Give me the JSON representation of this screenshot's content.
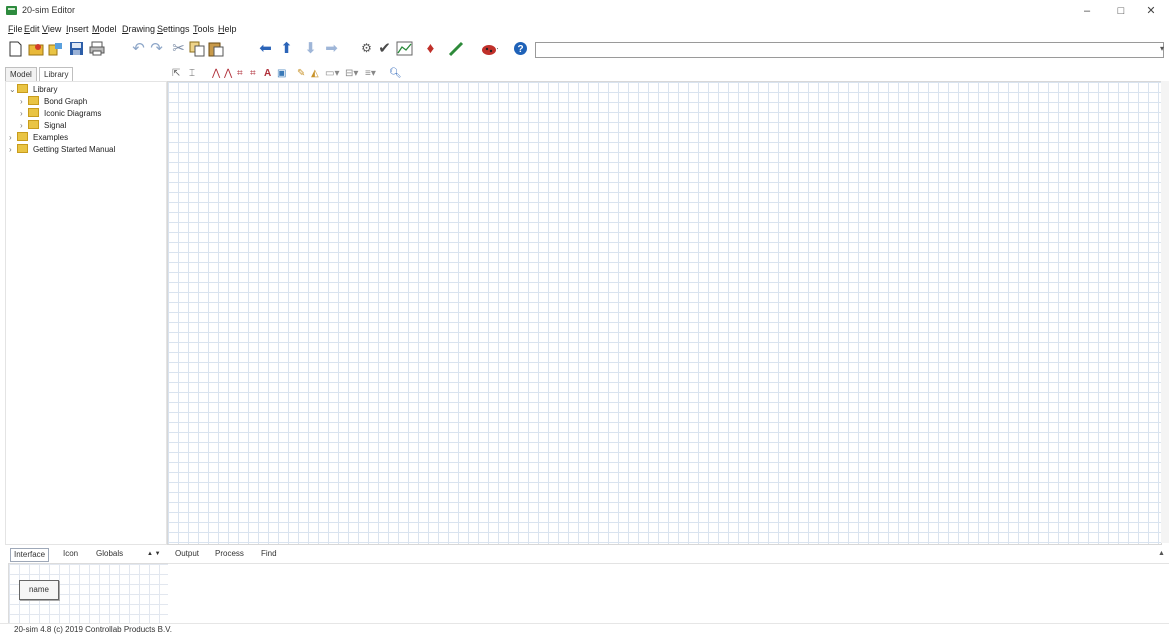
{
  "window": {
    "title": "20-sim Editor",
    "controls": {
      "minimize": "–",
      "maximize": "□",
      "close": "✕"
    }
  },
  "menu": [
    "File",
    "Edit",
    "View",
    "Insert",
    "Model",
    "Drawing",
    "Settings",
    "Tools",
    "Help"
  ],
  "toolbar": {
    "icons": [
      "new-file-icon",
      "open-folder-icon",
      "open-library-icon",
      "save-icon",
      "print-icon",
      "undo-icon",
      "redo-icon",
      "cut-icon",
      "copy-icon",
      "paste-icon",
      "go-back-icon",
      "go-up-icon",
      "go-down-icon",
      "go-forward-icon",
      "gear-icon",
      "check-icon",
      "simulator-icon",
      "insert-icon",
      "edit-pencil-icon",
      "ladybug-icon",
      "help-icon"
    ],
    "search_value": ""
  },
  "left_panel": {
    "tabs": [
      "Model",
      "Library"
    ],
    "active_tab": "Library",
    "tree": [
      {
        "label": "Library",
        "level": 0,
        "expanded": true
      },
      {
        "label": "Bond Graph",
        "level": 1,
        "expanded": false
      },
      {
        "label": "Iconic Diagrams",
        "level": 1,
        "expanded": false
      },
      {
        "label": "Signal",
        "level": 1,
        "expanded": false
      },
      {
        "label": "Examples",
        "level": 0,
        "expanded": false
      },
      {
        "label": "Getting Started Manual",
        "level": 0,
        "expanded": false
      }
    ]
  },
  "drawing_toolbar": {
    "icons": [
      "select-pointer-icon",
      "text-cursor-icon",
      "line-tool-icon",
      "polyline-tool-icon",
      "rectangle-tool-icon",
      "ellipse-tool-icon",
      "text-tool-icon",
      "image-tool-icon",
      "pen-color-icon",
      "fill-color-icon",
      "shape-dropdown-icon",
      "align-dropdown-icon",
      "distribute-dropdown-icon",
      "zoom-icon"
    ]
  },
  "bottom_left": {
    "tabs": [
      "Interface",
      "Icon",
      "Globals"
    ],
    "active_tab": "Interface",
    "arrows": "▲ ▼",
    "name_box": "name"
  },
  "bottom_right": {
    "tabs": [
      "Output",
      "Process",
      "Find"
    ]
  },
  "status": "20-sim 4.8 (c) 2019 Controllab Products B.V."
}
